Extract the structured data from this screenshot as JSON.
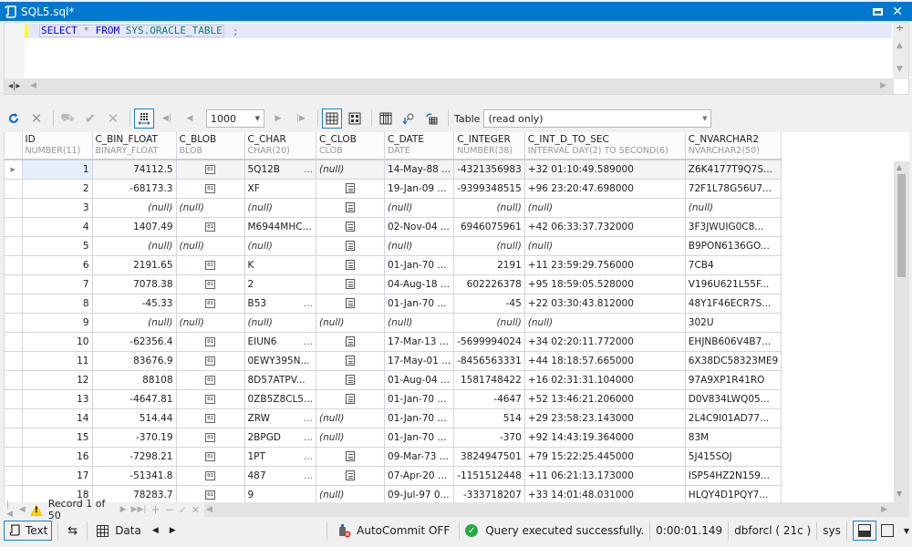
{
  "window": {
    "title": "SQL5.sql*"
  },
  "editor": {
    "sql_keyword_select": "SELECT",
    "sql_star": "*",
    "sql_keyword_from": "FROM",
    "sql_object": "SYS.ORACLE_TABLE",
    "sql_terminator": ";"
  },
  "toolbar": {
    "page_size": "1000",
    "table_label": "Table",
    "table_mode": "(read only)"
  },
  "grid": {
    "columns": [
      {
        "name": "ID",
        "type": "NUMBER(11)"
      },
      {
        "name": "C_BIN_FLOAT",
        "type": "BINARY_FLOAT"
      },
      {
        "name": "C_BLOB",
        "type": "BLOB"
      },
      {
        "name": "C_CHAR",
        "type": "CHAR(20)"
      },
      {
        "name": "C_CLOB",
        "type": "CLOB"
      },
      {
        "name": "C_DATE",
        "type": "DATE"
      },
      {
        "name": "C_INTEGER",
        "type": "NUMBER(38)"
      },
      {
        "name": "C_INT_D_TO_SEC",
        "type": "INTERVAL DAY(2) TO SECOND(6)"
      },
      {
        "name": "C_NVARCHAR2",
        "type": "NVARCHAR2(50)"
      }
    ],
    "null_text": "(null)",
    "blob_icon_text": "01",
    "rows": [
      {
        "id": "1",
        "bin_float": "74112.5",
        "blob": "icon",
        "char": "5Q12B",
        "char_trunc": true,
        "clob": "null",
        "date": "14-May-88 ...",
        "integer": "-4321356983",
        "interval": "+32 01:10:49.589000",
        "nvarchar2": "Z6K4177T9Q7S..."
      },
      {
        "id": "2",
        "bin_float": "-68173.3",
        "blob": "icon",
        "char": "XF",
        "char_trunc": false,
        "clob": "icon",
        "date": "19-Jan-09 ...",
        "integer": "-9399348515",
        "interval": "+96 23:20:47.698000",
        "nvarchar2": "72F1L78G56U7..."
      },
      {
        "id": "3",
        "bin_float": null,
        "blob": "null",
        "char": null,
        "char_trunc": false,
        "clob": "icon",
        "date": null,
        "integer": null,
        "interval": null,
        "nvarchar2": null
      },
      {
        "id": "4",
        "bin_float": "1407.49",
        "blob": "icon",
        "char": "M6944MHC...",
        "char_trunc": false,
        "clob": "icon",
        "date": "02-Nov-04 ...",
        "integer": "6946075961",
        "interval": "+42 06:33:37.732000",
        "nvarchar2": "3F3JWUIG0C8..."
      },
      {
        "id": "5",
        "bin_float": null,
        "blob": "null",
        "char": null,
        "char_trunc": false,
        "clob": "icon",
        "date": null,
        "integer": null,
        "interval": null,
        "nvarchar2": "B9PON6136GO..."
      },
      {
        "id": "6",
        "bin_float": "2191.65",
        "blob": "icon",
        "char": "K",
        "char_trunc": false,
        "clob": "icon",
        "date": "01-Jan-70 ...",
        "integer": "2191",
        "interval": "+11 23:59:29.756000",
        "nvarchar2": "7CB4"
      },
      {
        "id": "7",
        "bin_float": "7078.38",
        "blob": "icon",
        "char": "2",
        "char_trunc": false,
        "clob": "icon",
        "date": "04-Aug-18 ...",
        "integer": "602226378",
        "interval": "+95 18:59:05.528000",
        "nvarchar2": "V196U621L55F..."
      },
      {
        "id": "8",
        "bin_float": "-45.33",
        "blob": "icon",
        "char": "B53",
        "char_trunc": true,
        "clob": "icon",
        "date": "01-Jan-70 ...",
        "integer": "-45",
        "interval": "+22 03:30:43.812000",
        "nvarchar2": "48Y1F46ECR7S..."
      },
      {
        "id": "9",
        "bin_float": null,
        "blob": "null",
        "char": null,
        "char_trunc": false,
        "clob": "null",
        "date": null,
        "integer": null,
        "interval": null,
        "nvarchar2": "302U"
      },
      {
        "id": "10",
        "bin_float": "-62356.4",
        "blob": "icon",
        "char": "EIUN6",
        "char_trunc": true,
        "clob": "icon",
        "date": "17-Mar-13 ...",
        "integer": "-5699994024",
        "interval": "+34 02:20:11.772000",
        "nvarchar2": "EHJNB606V4B7..."
      },
      {
        "id": "11",
        "bin_float": "83676.9",
        "blob": "icon",
        "char": "0EWY395N...",
        "char_trunc": false,
        "clob": "icon",
        "date": "17-May-01 ...",
        "integer": "-8456563331",
        "interval": "+44 18:18:57.665000",
        "nvarchar2": "6X38DC58323ME9"
      },
      {
        "id": "12",
        "bin_float": "88108",
        "blob": "icon",
        "char": "8D57ATPV...",
        "char_trunc": false,
        "clob": "icon",
        "date": "01-Aug-04 ...",
        "integer": "1581748422",
        "interval": "+16 02:31:31.104000",
        "nvarchar2": "97A9XP1R41RO"
      },
      {
        "id": "13",
        "bin_float": "-4647.81",
        "blob": "icon",
        "char": "0ZB5Z8CL5...",
        "char_trunc": false,
        "clob": "icon",
        "date": "01-Jan-70 ...",
        "integer": "-4647",
        "interval": "+52 13:46:21.206000",
        "nvarchar2": "D0V834LWQ05..."
      },
      {
        "id": "14",
        "bin_float": "514.44",
        "blob": "icon",
        "char": "ZRW",
        "char_trunc": true,
        "clob": "null",
        "date": "01-Jan-70 ...",
        "integer": "514",
        "interval": "+29 23:58:23.143000",
        "nvarchar2": "2L4C9I01AD77..."
      },
      {
        "id": "15",
        "bin_float": "-370.19",
        "blob": "icon",
        "char": "2BPGD",
        "char_trunc": true,
        "clob": "null",
        "date": "01-Jan-70 ...",
        "integer": "-370",
        "interval": "+92 14:43:19.364000",
        "nvarchar2": "83M"
      },
      {
        "id": "16",
        "bin_float": "-7298.21",
        "blob": "icon",
        "char": "1PT",
        "char_trunc": true,
        "clob": "icon",
        "date": "09-Mar-73 ...",
        "integer": "3824947501",
        "interval": "+79 15:22:25.445000",
        "nvarchar2": "5J415SOJ"
      },
      {
        "id": "17",
        "bin_float": "-51341.8",
        "blob": "icon",
        "char": "487",
        "char_trunc": true,
        "clob": "icon",
        "date": "07-Apr-20 ...",
        "integer": "-1151512448",
        "interval": "+11 06:21:13.173000",
        "nvarchar2": "ISP54HZ2N159..."
      },
      {
        "id": "18",
        "bin_float": "78283.7",
        "blob": "icon",
        "char": "9",
        "char_trunc": false,
        "clob": "null",
        "date": "09-Jul-97 0...",
        "integer": "-333718207",
        "interval": "+33 14:01:48.031000",
        "nvarchar2": "HLQY4D1PQY7..."
      }
    ]
  },
  "navigator": {
    "record_text": "Record 1 of 50"
  },
  "statusbar": {
    "text_tab": "Text",
    "data_tab": "Data",
    "autocommit": "AutoCommit OFF",
    "status_message": "Query executed successfully.",
    "elapsed": "0:00:01.149",
    "connection": "dbforcl ( 21c )",
    "user": "sys"
  }
}
